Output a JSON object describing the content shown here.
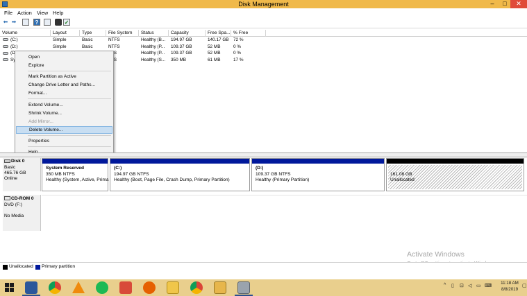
{
  "window": {
    "title": "Disk Management",
    "min": "–",
    "max": "□",
    "close": "✕"
  },
  "menu": [
    "File",
    "Action",
    "View",
    "Help"
  ],
  "toolbar": [
    "back-icon",
    "forward-icon",
    "list-view-icon",
    "help-icon",
    "properties-icon",
    "disk-icon",
    "check-icon"
  ],
  "table": {
    "columns": [
      "Volume",
      "Layout",
      "Type",
      "File System",
      "Status",
      "Capacity",
      "Free Spa...",
      "% Free"
    ],
    "rows": [
      {
        "volume": "(C:)",
        "layout": "Simple",
        "type": "Basic",
        "fs": "NTFS",
        "status": "Healthy (B...",
        "capacity": "194.97 GB",
        "free": "140.17 GB",
        "pct": "72 %"
      },
      {
        "volume": "(D:)",
        "layout": "Simple",
        "type": "Basic",
        "fs": "NTFS",
        "status": "Healthy (P...",
        "capacity": "109.37 GB",
        "free": "52 MB",
        "pct": "0 %"
      },
      {
        "volume": "(D",
        "layout": "",
        "type": "",
        "fs": "TFS",
        "status": "Healthy (P...",
        "capacity": "109.37 GB",
        "free": "52 MB",
        "pct": "0 %"
      },
      {
        "volume": "Sys",
        "layout": "",
        "type": "",
        "fs": "TFS",
        "status": "Healthy (S...",
        "capacity": "350 MB",
        "free": "61 MB",
        "pct": "17 %"
      }
    ]
  },
  "context_menu": {
    "items": [
      "Open",
      "Explore",
      "Mark Partition as Active",
      "Change Drive Letter and Paths...",
      "Format...",
      "Extend Volume...",
      "Shrink Volume...",
      "Add Mirror...",
      "Delete Volume...",
      "Properties",
      "Help"
    ],
    "disabled": "Add Mirror...",
    "selected": "Delete Volume..."
  },
  "disk0": {
    "name": "Disk 0",
    "type": "Basic",
    "size": "465.76 GB",
    "state": "Online",
    "partitions": [
      {
        "name": "System Reserved",
        "detail": "350 MB NTFS",
        "status": "Healthy (System, Active, Prima"
      },
      {
        "name": "(C:)",
        "detail": "194.97 GB NTFS",
        "status": "Healthy (Boot, Page File, Crash Dump, Primary Partition)"
      },
      {
        "name": "(D:)",
        "detail": "109.37 GB NTFS",
        "status": "Healthy (Primary Partition)"
      },
      {
        "name": "",
        "detail": "161.08 GB",
        "status": "Unallocated"
      }
    ]
  },
  "cdrom0": {
    "name": "CD-ROM 0",
    "drive": "DVD (F:)",
    "media": "No Media"
  },
  "legend": {
    "unallocated": "Unallocated",
    "primary": "Primary partition",
    "unallocated_color": "#000000",
    "primary_color": "#00189b"
  },
  "watermark": {
    "title": "Activate Windows",
    "subtitle": "Go to PC settings to activate Windows."
  },
  "taskbar": {
    "apps": [
      "windows-start-icon",
      "word-icon",
      "chrome-icon",
      "vlc-icon",
      "spotify-icon",
      "paint-icon",
      "firefox-icon",
      "folder-icon",
      "chrome-icon",
      "file-explorer-icon",
      "disk-management-icon"
    ],
    "time": "11:18 AM",
    "date": "8/8/2019"
  }
}
